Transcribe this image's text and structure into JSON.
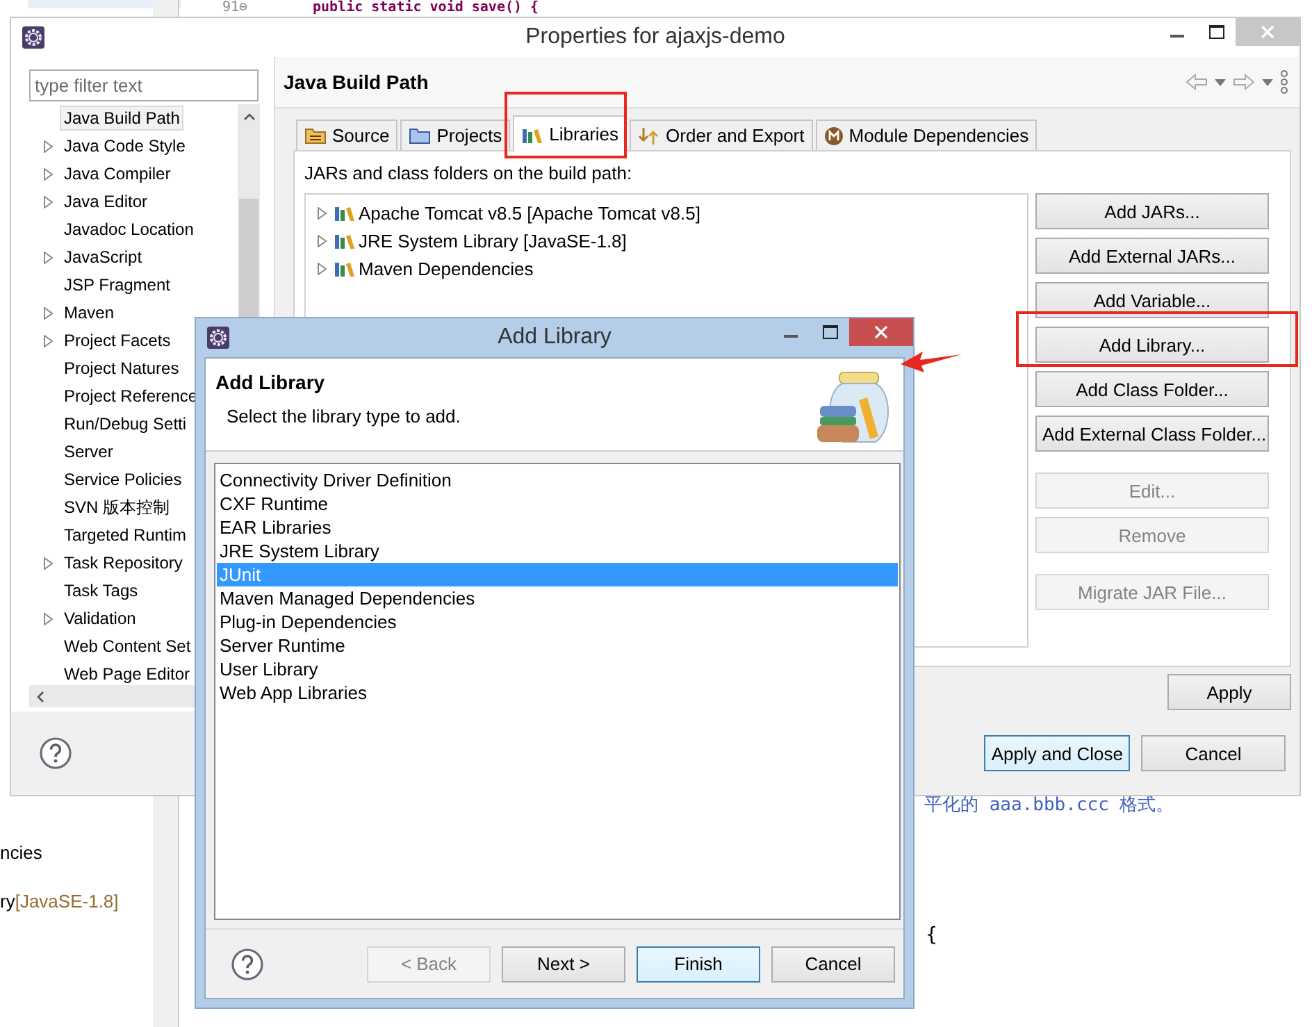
{
  "background": {
    "line_number": "91⊖",
    "code_line": "public static void save() {",
    "comment": "平化的 aaa.bbb.ccc 格式。",
    "brace": "{",
    "outline_items": [
      {
        "name": "ncies"
      },
      {
        "name": "ry",
        "decoration": "[JavaSE-1.8]"
      }
    ]
  },
  "properties": {
    "title": "Properties for ajaxjs-demo",
    "filter": {
      "placeholder": "type filter text"
    },
    "tree": [
      {
        "label": "Java Build Path",
        "expandable": false,
        "selected": true
      },
      {
        "label": "Java Code Style",
        "expandable": true,
        "selected": false
      },
      {
        "label": "Java Compiler",
        "expandable": true,
        "selected": false
      },
      {
        "label": "Java Editor",
        "expandable": true,
        "selected": false
      },
      {
        "label": "Javadoc Location",
        "expandable": false,
        "selected": false
      },
      {
        "label": "JavaScript",
        "expandable": true,
        "selected": false
      },
      {
        "label": "JSP Fragment",
        "expandable": false,
        "selected": false
      },
      {
        "label": "Maven",
        "expandable": true,
        "selected": false
      },
      {
        "label": "Project Facets",
        "expandable": true,
        "selected": false
      },
      {
        "label": "Project Natures",
        "expandable": false,
        "selected": false
      },
      {
        "label": "Project Reference",
        "expandable": false,
        "selected": false
      },
      {
        "label": "Run/Debug Setti",
        "expandable": false,
        "selected": false
      },
      {
        "label": "Server",
        "expandable": false,
        "selected": false
      },
      {
        "label": "Service Policies",
        "expandable": false,
        "selected": false
      },
      {
        "label": "SVN 版本控制",
        "expandable": false,
        "selected": false
      },
      {
        "label": "Targeted Runtim",
        "expandable": false,
        "selected": false
      },
      {
        "label": "Task Repository",
        "expandable": true,
        "selected": false
      },
      {
        "label": "Task Tags",
        "expandable": false,
        "selected": false
      },
      {
        "label": "Validation",
        "expandable": true,
        "selected": false
      },
      {
        "label": "Web Content Set",
        "expandable": false,
        "selected": false
      },
      {
        "label": "Web Page Editor",
        "expandable": false,
        "selected": false
      }
    ],
    "page_title": "Java Build Path",
    "tabs": [
      {
        "label": "Source",
        "selected": false
      },
      {
        "label": "Projects",
        "selected": false
      },
      {
        "label": "Libraries",
        "selected": true
      },
      {
        "label": "Order and Export",
        "selected": false
      },
      {
        "label": "Module Dependencies",
        "selected": false
      }
    ],
    "build_path_label": "JARs and class folders on the build path:",
    "entries": [
      {
        "label": "Apache Tomcat v8.5 [Apache Tomcat v8.5]"
      },
      {
        "label": "JRE System Library [JavaSE-1.8]"
      },
      {
        "label": "Maven Dependencies"
      }
    ],
    "button_groups": [
      [
        {
          "label": "Add JARs...",
          "disabled": false
        },
        {
          "label": "Add External JARs...",
          "disabled": false
        },
        {
          "label": "Add Variable...",
          "disabled": false
        },
        {
          "label": "Add Library...",
          "disabled": false
        },
        {
          "label": "Add Class Folder...",
          "disabled": false
        },
        {
          "label": "Add External Class Folder...",
          "disabled": false
        }
      ],
      [
        {
          "label": "Edit...",
          "disabled": true
        },
        {
          "label": "Remove",
          "disabled": true
        }
      ],
      [
        {
          "label": "Migrate JAR File...",
          "disabled": true
        }
      ]
    ],
    "apply": "Apply",
    "footer_buttons": [
      {
        "label": "Apply and Close",
        "default": true
      },
      {
        "label": "Cancel",
        "default": false
      }
    ]
  },
  "dialog": {
    "title": "Add Library",
    "heading": "Add Library",
    "description": "Select the library type to add.",
    "libraries": [
      {
        "label": "Connectivity Driver Definition",
        "selected": false
      },
      {
        "label": "CXF Runtime",
        "selected": false
      },
      {
        "label": "EAR Libraries",
        "selected": false
      },
      {
        "label": "JRE System Library",
        "selected": false
      },
      {
        "label": "JUnit",
        "selected": true
      },
      {
        "label": "Maven Managed Dependencies",
        "selected": false
      },
      {
        "label": "Plug-in Dependencies",
        "selected": false
      },
      {
        "label": "Server Runtime",
        "selected": false
      },
      {
        "label": "User Library",
        "selected": false
      },
      {
        "label": "Web App Libraries",
        "selected": false
      }
    ],
    "buttons": [
      {
        "label": "< Back",
        "disabled": true,
        "default": false
      },
      {
        "label": "Next >",
        "disabled": false,
        "default": false
      },
      {
        "label": "Finish",
        "disabled": false,
        "default": true
      },
      {
        "label": "Cancel",
        "disabled": false,
        "default": false
      }
    ]
  }
}
